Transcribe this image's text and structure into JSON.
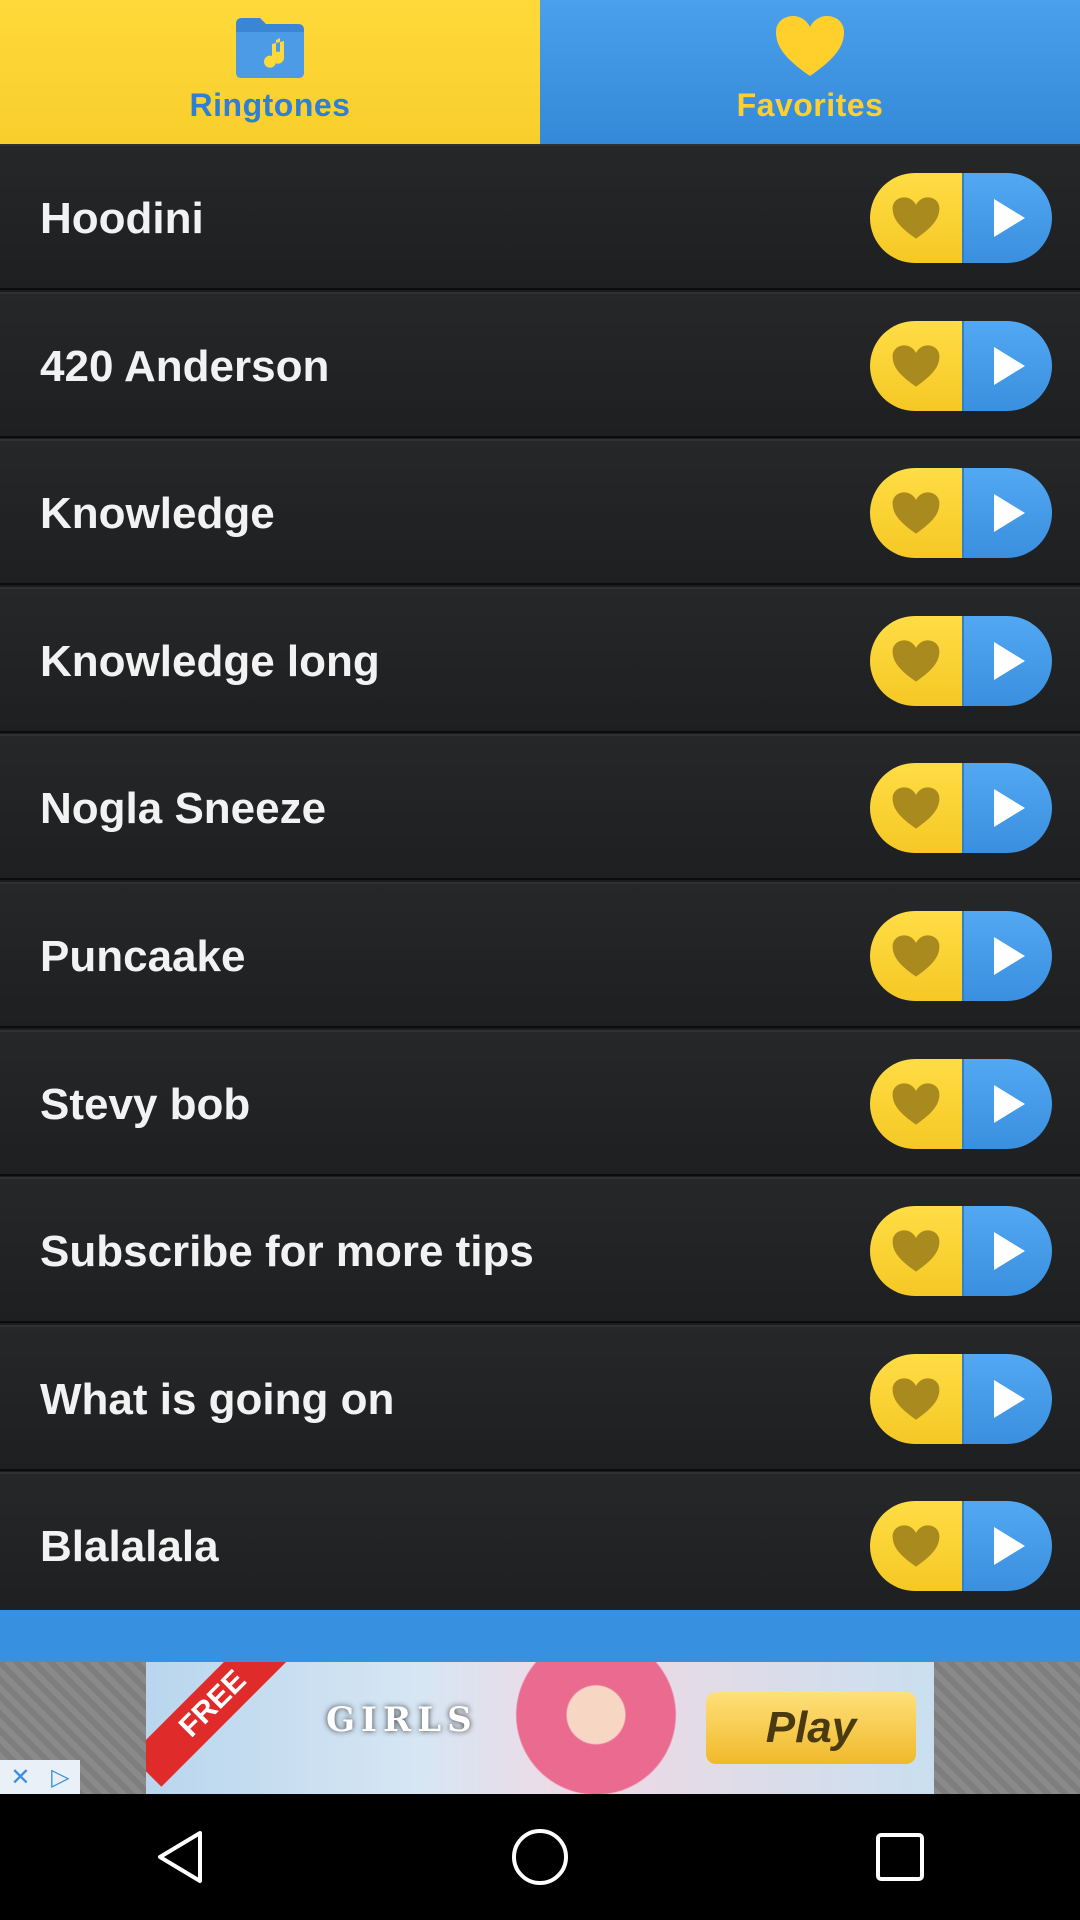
{
  "tabs": [
    {
      "label": "Ringtones",
      "icon": "music-folder-icon",
      "active": true
    },
    {
      "label": "Favorites",
      "icon": "heart-icon",
      "active": false
    }
  ],
  "ringtones": [
    {
      "title": "Hoodini"
    },
    {
      "title": "420 Anderson"
    },
    {
      "title": "Knowledge"
    },
    {
      "title": "Knowledge long"
    },
    {
      "title": "Nogla Sneeze"
    },
    {
      "title": "Puncaake"
    },
    {
      "title": "Stevy bob"
    },
    {
      "title": "Subscribe for more tips"
    },
    {
      "title": "What is going on"
    },
    {
      "title": "Blalalala"
    }
  ],
  "ad": {
    "badge": "FREE",
    "logo": "GIRLS",
    "button": "Play",
    "close_icons": [
      "close-icon",
      "adchoices-icon"
    ]
  },
  "colors": {
    "yellow": "#f8ce2c",
    "blue": "#3489d8",
    "row_bg": "#232426"
  },
  "navbar": [
    "back-icon",
    "home-icon",
    "recents-icon"
  ]
}
